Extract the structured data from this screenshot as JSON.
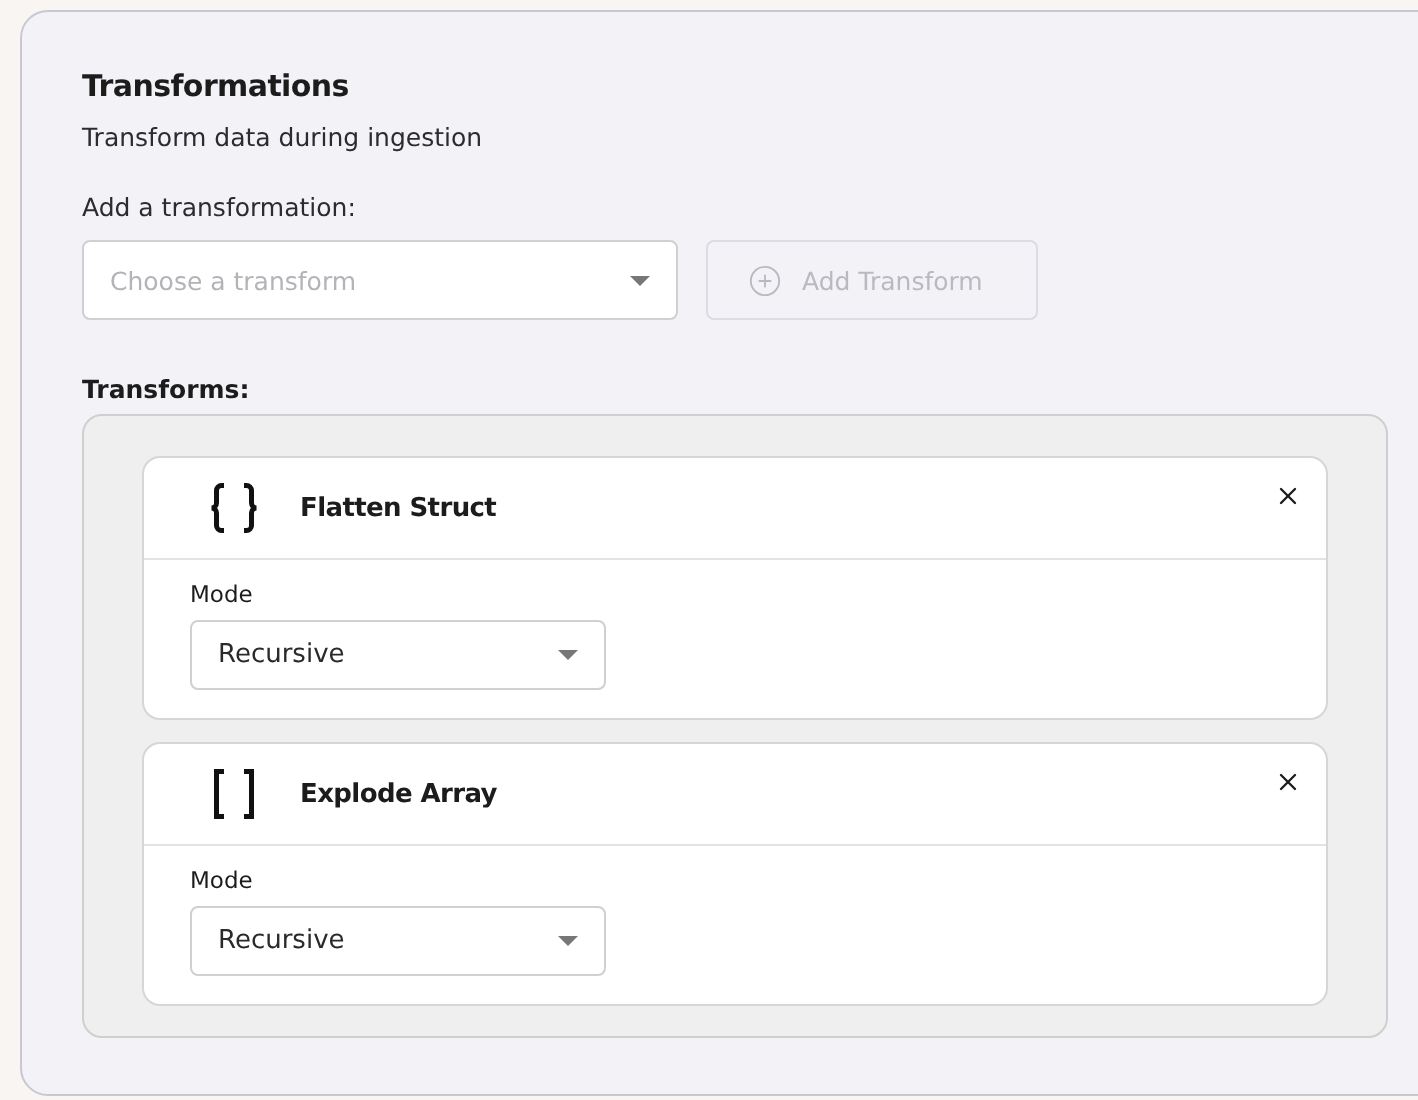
{
  "section": {
    "title": "Transformations",
    "subtitle": "Transform data during ingestion"
  },
  "add": {
    "label": "Add a transformation:",
    "select": {
      "placeholder": "Choose a transform"
    },
    "button": {
      "label": "Add Transform",
      "disabled": true
    }
  },
  "transforms_label": "Transforms:",
  "transforms": [
    {
      "kind": "struct",
      "title": "Flatten Struct",
      "field_label": "Mode",
      "value": "Recursive"
    },
    {
      "kind": "array",
      "title": "Explode Array",
      "field_label": "Mode",
      "value": "Recursive"
    }
  ]
}
